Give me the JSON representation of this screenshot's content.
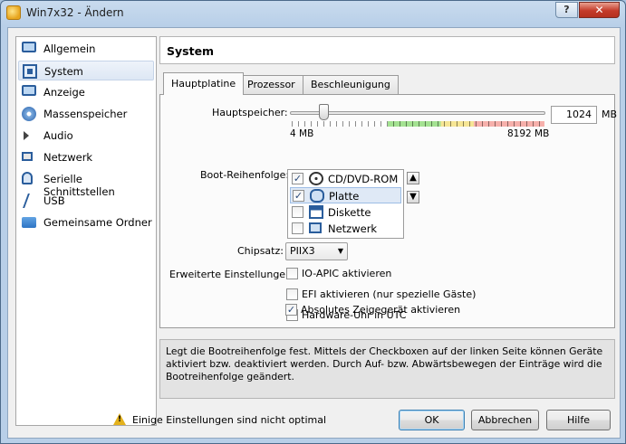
{
  "window": {
    "title": "Win7x32 - Ändern",
    "help_glyph": "?",
    "close_glyph": "✕"
  },
  "sidebar": {
    "items": [
      {
        "label": "Allgemein",
        "icon": "monitor-icon"
      },
      {
        "label": "System",
        "icon": "chip-icon",
        "selected": true
      },
      {
        "label": "Anzeige",
        "icon": "display-icon"
      },
      {
        "label": "Massenspeicher",
        "icon": "storage-disk-icon"
      },
      {
        "label": "Audio",
        "icon": "speaker-icon"
      },
      {
        "label": "Netzwerk",
        "icon": "network-icon"
      },
      {
        "label": "Serielle Schnittstellen",
        "icon": "serial-port-icon"
      },
      {
        "label": "USB",
        "icon": "usb-icon"
      },
      {
        "label": "Gemeinsame Ordner",
        "icon": "shared-folder-icon"
      }
    ]
  },
  "header": {
    "title": "System"
  },
  "tabs": [
    {
      "label": "Hauptplatine",
      "active": true
    },
    {
      "label": "Prozessor",
      "active": false
    },
    {
      "label": "Beschleunigung",
      "active": false
    }
  ],
  "motherboard": {
    "memory_label": "Hauptspeicher:",
    "memory_value": "1024",
    "memory_unit": "MB",
    "memory_min": "4 MB",
    "memory_max": "8192 MB",
    "memory_fraction": 0.125,
    "boot_order_label": "Boot-Reihenfolge:",
    "boot_items": [
      {
        "label": "CD/DVD-ROM",
        "checked": true,
        "icon": "cd-dvd-icon"
      },
      {
        "label": "Platte",
        "checked": true,
        "icon": "hard-disk-icon",
        "selected": true
      },
      {
        "label": "Diskette",
        "checked": false,
        "icon": "floppy-icon"
      },
      {
        "label": "Netzwerk",
        "checked": false,
        "icon": "network-boot-icon"
      }
    ],
    "chipset_label": "Chipsatz:",
    "chipset_value": "PIIX3",
    "extended_label": "Erweiterte Einstellungen:",
    "options": [
      {
        "label": "IO-APIC aktivieren",
        "checked": false
      },
      {
        "label": "EFI aktivieren (nur spezielle Gäste)",
        "checked": false
      },
      {
        "label": "Hardware-Uhr in UTC",
        "checked": false
      },
      {
        "label": "Absolutes Zeigegerät aktivieren",
        "checked": true
      }
    ]
  },
  "info_text": "Legt die Bootreihenfolge fest. Mittels der Checkboxen auf der linken Seite können Geräte aktiviert bzw. deaktiviert werden. Durch Auf- bzw. Abwärtsbewegen der Einträge wird die Bootreihenfolge geändert.",
  "footer": {
    "warning_text": "Einige Einstellungen sind nicht optimal",
    "ok_label": "OK",
    "cancel_label": "Abbrechen",
    "help_label": "Hilfe"
  },
  "colors": {
    "accent": "#3c7fb1",
    "titlebar": "#b8cfe8",
    "selection": "#dfe9f6"
  }
}
